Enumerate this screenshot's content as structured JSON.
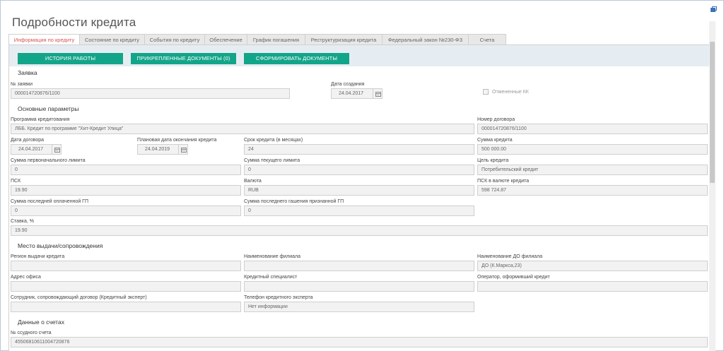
{
  "page": {
    "title": "Подробности кредита"
  },
  "tabs": [
    {
      "label": "Информация по кредиту",
      "active": true
    },
    {
      "label": "Состояние по кредиту"
    },
    {
      "label": "События по кредиту"
    },
    {
      "label": "Обеспечение"
    },
    {
      "label": "График погашения"
    },
    {
      "label": "Реструктуризация кредита"
    },
    {
      "label": "Федеральный закон №230-ФЗ"
    },
    {
      "label": "Счета"
    }
  ],
  "toolbar": {
    "history_label": "ИСТОРИЯ РАБОТЫ",
    "attached_docs_label": "ПРИКРЕПЛЕННЫЕ ДОКУМЕНТЫ (0)",
    "generate_docs_label": "СФОРМИРОВАТЬ ДОКУМЕНТЫ"
  },
  "application": {
    "section_title": "Заявка",
    "number_label": "№ заявки",
    "number_value": "000014720876/1100",
    "created_label": "Дата создания",
    "created_value": "24.04.2017",
    "cancelled_kk_label": "Отмененные КК"
  },
  "main_params": {
    "section_title": "Основные параметры",
    "program_label": "Программа кредитования",
    "program_value": "ЛББ. Кредит по программе \"Хит-Кредит Улица\"",
    "contract_no_label": "Номер договора",
    "contract_no_value": "000014720876/1100",
    "contract_date_label": "Дата договора",
    "contract_date_value": "24.04.2017",
    "planned_end_label": "Плановая дата окончания кредита",
    "planned_end_value": "24.04.2019",
    "term_label": "Срок кредита (в месяцах)",
    "term_value": "24",
    "amount_label": "Сумма кредита",
    "amount_value": "500 000.00",
    "initial_limit_label": "Сумма первоначального лимита",
    "initial_limit_value": "0",
    "current_limit_label": "Сумма текущего лимита",
    "current_limit_value": "0",
    "purpose_label": "Цель кредита",
    "purpose_value": "Потребительский кредит",
    "psk_label": "ПСК",
    "psk_value": "19.90",
    "currency_label": "Валюта",
    "currency_value": "RUB",
    "psk_currency_label": "ПСК в валюте кредита",
    "psk_currency_value": "598 724.87",
    "last_paid_gp_label": "Сумма последней оплаченной ГП",
    "last_paid_gp_value": "0",
    "last_repaid_gp_label": "Сумма последнего гашения признанной ГП",
    "last_repaid_gp_value": "0",
    "rate_label": "Ставка, %",
    "rate_value": "19.90"
  },
  "place": {
    "section_title": "Место выдачи/сопровождения",
    "region_label": "Регион выдачи кредита",
    "region_value": "",
    "branch_label": "Наименование филиала",
    "branch_value": "",
    "do_branch_label": "Наименование ДО филиала",
    "do_branch_value": "ДО (К.Маркса,23)",
    "office_label": "Адрес офиса",
    "office_value": "",
    "specialist_label": "Кредитный специалист",
    "specialist_value": "",
    "operator_label": "Оператор, оформивший кредит",
    "operator_value": "",
    "employee_label": "Сотрудник, сопровождающий договор (Кредитный эксперт)",
    "employee_value": "",
    "expert_phone_label": "Телефон кредитного эксперта",
    "expert_phone_value": "Нет информации"
  },
  "accounts": {
    "section_title": "Данные о счетах",
    "loan_account_label": "№ ссудного счета",
    "loan_account_value": "45506810611004720876"
  }
}
